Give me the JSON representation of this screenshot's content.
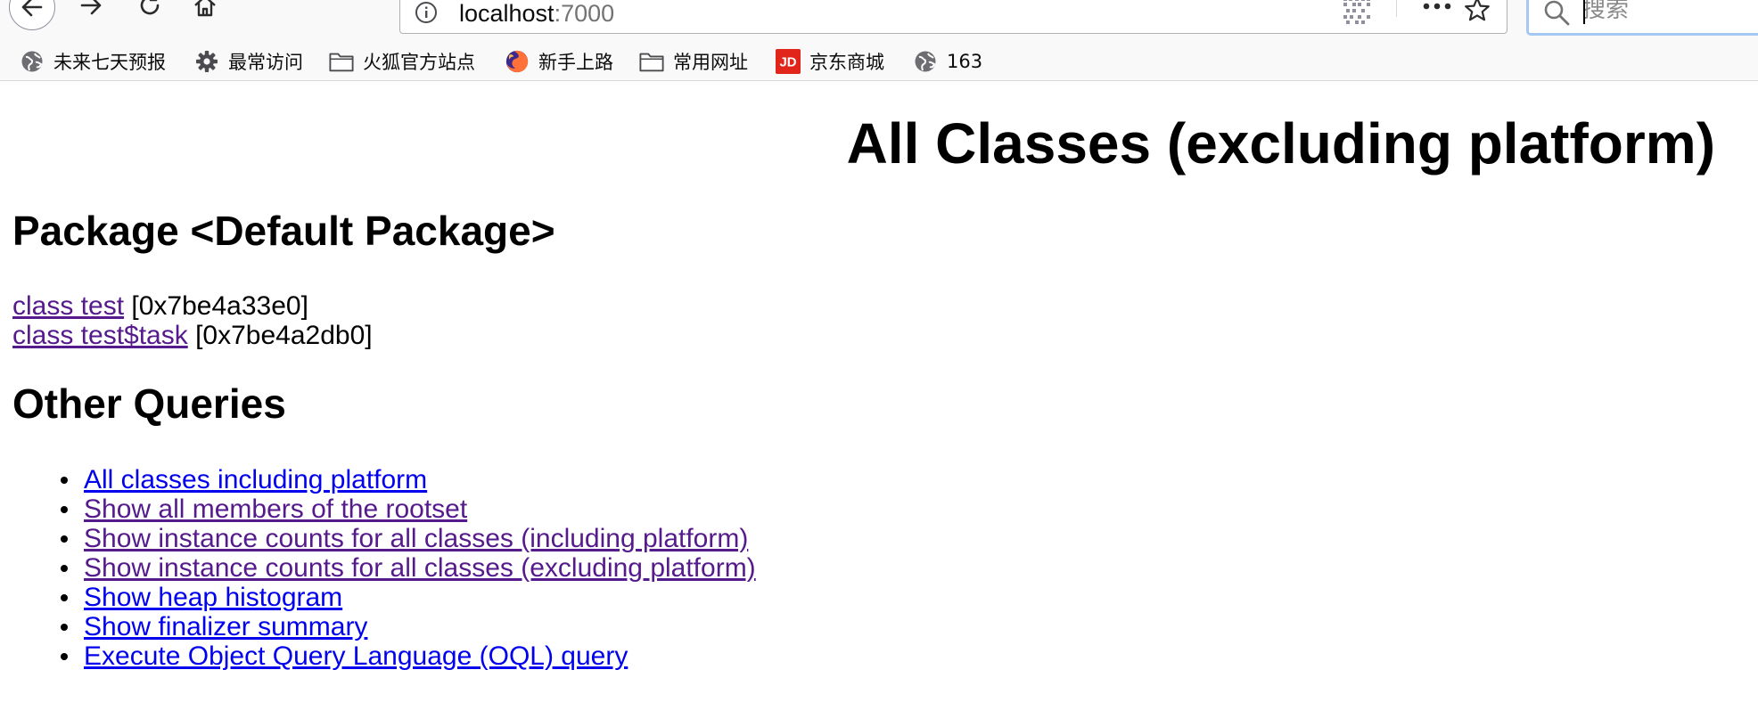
{
  "browser": {
    "url_host": "localhost",
    "url_port": ":7000",
    "search_placeholder": "搜索",
    "bookmarks": [
      {
        "label": "未来七天预报",
        "icon": "globe-icon"
      },
      {
        "label": "最常访问",
        "icon": "gear-icon"
      },
      {
        "label": "火狐官方站点",
        "icon": "folder-icon"
      },
      {
        "label": "新手上路",
        "icon": "firefox-icon"
      },
      {
        "label": "常用网址",
        "icon": "folder-icon"
      },
      {
        "label": "京东商城",
        "icon": "jd-icon"
      },
      {
        "label": "163",
        "icon": "globe-icon"
      }
    ]
  },
  "page": {
    "title": "All Classes (excluding platform)",
    "package_heading": "Package <Default Package>",
    "classes": [
      {
        "link": "class test",
        "address": "[0x7be4a33e0]"
      },
      {
        "link": "class test$task",
        "address": "[0x7be4a2db0]"
      }
    ],
    "other_heading": "Other Queries",
    "queries": [
      {
        "label": "All classes including platform",
        "visited": false
      },
      {
        "label": "Show all members of the rootset",
        "visited": true
      },
      {
        "label": "Show instance counts for all classes (including platform)",
        "visited": true
      },
      {
        "label": "Show instance counts for all classes (excluding platform)",
        "visited": true
      },
      {
        "label": "Show heap histogram",
        "visited": false
      },
      {
        "label": "Show finalizer summary",
        "visited": false
      },
      {
        "label": "Execute Object Query Language (OQL) query",
        "visited": false
      }
    ]
  },
  "colors": {
    "link_unvisited": "#0000ee",
    "link_visited": "#551a8b",
    "jd_brand": "#e1251b",
    "search_focus": "#a5c8f2"
  }
}
